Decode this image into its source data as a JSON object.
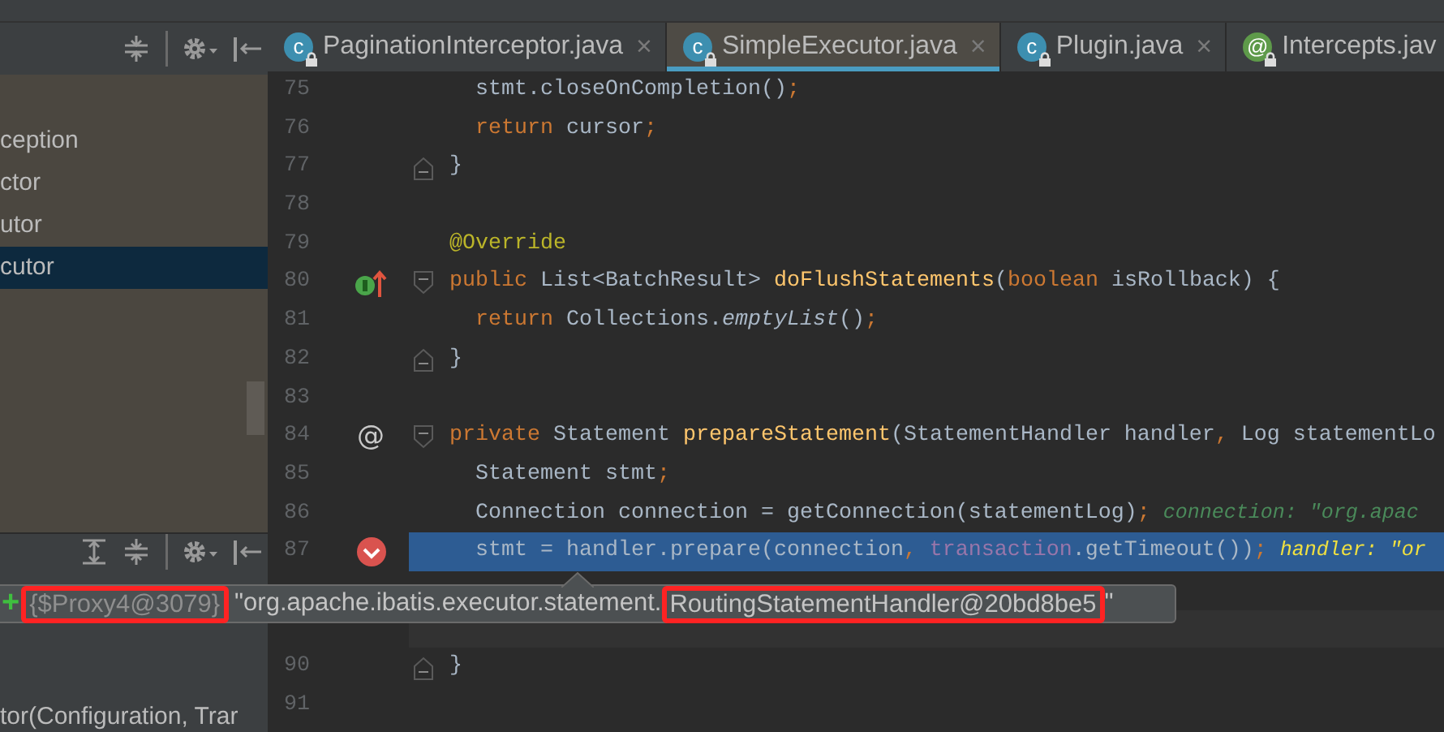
{
  "structure_panel": {
    "items": [
      {
        "label": "ception",
        "selected": false
      },
      {
        "label": "ctor",
        "selected": false
      },
      {
        "label": "utor",
        "selected": false
      },
      {
        "label": "cutor",
        "selected": true
      }
    ],
    "bottom_text": "tor(Configuration, Trar"
  },
  "tabs": [
    {
      "label": "PaginationInterceptor.java",
      "selected": false,
      "glyph": "c",
      "color": "#3d8fb0",
      "close": "×"
    },
    {
      "label": "SimpleExecutor.java",
      "selected": true,
      "glyph": "c",
      "color": "#3d8fb0",
      "close": "×"
    },
    {
      "label": "Plugin.java",
      "selected": false,
      "glyph": "c",
      "color": "#3d8fb0",
      "close": "×"
    },
    {
      "label": "Intercepts.jav",
      "selected": false,
      "glyph": "@",
      "color": "#5e9a4a"
    }
  ],
  "lines": [
    {
      "number": "75",
      "tokens": [
        {
          "text": "  stmt.closeOnCompletion()",
          "kind": "plain"
        },
        {
          "text": ";",
          "kind": "kw"
        }
      ]
    },
    {
      "number": "76",
      "tokens": [
        {
          "text": "  return",
          "kind": "kw"
        },
        {
          "text": " cursor",
          "kind": "plain"
        },
        {
          "text": ";",
          "kind": "kw"
        }
      ]
    },
    {
      "number": "77",
      "fold": {
        "kind": "end"
      },
      "tokens": [
        {
          "text": "}",
          "kind": "plain"
        }
      ]
    },
    {
      "number": "78"
    },
    {
      "number": "79",
      "tokens": [
        {
          "text": "@Override",
          "kind": "annotation"
        }
      ]
    },
    {
      "number": "80",
      "gutter": {
        "kind": "implements"
      },
      "fold": {
        "kind": "start"
      },
      "tokens": [
        {
          "text": "public",
          "kind": "kw"
        },
        {
          "text": " List<BatchResult> ",
          "kind": "plain"
        },
        {
          "text": "doFlushStatements",
          "kind": "method"
        },
        {
          "text": "(",
          "kind": "plain"
        },
        {
          "text": "boolean",
          "kind": "kw"
        },
        {
          "text": " isRollback) {",
          "kind": "plain"
        }
      ]
    },
    {
      "number": "81",
      "tokens": [
        {
          "text": "  return",
          "kind": "kw"
        },
        {
          "text": " Collections.",
          "kind": "plain"
        },
        {
          "text": "emptyList",
          "kind": "static"
        },
        {
          "text": "()",
          "kind": "plain"
        },
        {
          "text": ";",
          "kind": "kw"
        }
      ]
    },
    {
      "number": "82",
      "fold": {
        "kind": "end"
      },
      "tokens": [
        {
          "text": "}",
          "kind": "plain"
        }
      ]
    },
    {
      "number": "83"
    },
    {
      "number": "84",
      "gutter": {
        "kind": "glyph",
        "glyph": "@"
      },
      "fold": {
        "kind": "start"
      },
      "tokens": [
        {
          "text": "private",
          "kind": "kw"
        },
        {
          "text": " Statement ",
          "kind": "plain"
        },
        {
          "text": "prepareStatement",
          "kind": "method"
        },
        {
          "text": "(StatementHandler handler",
          "kind": "plain"
        },
        {
          "text": ",",
          "kind": "kw"
        },
        {
          "text": " Log statementLo",
          "kind": "plain"
        }
      ]
    },
    {
      "number": "85",
      "tokens": [
        {
          "text": "  Statement stmt",
          "kind": "plain"
        },
        {
          "text": ";",
          "kind": "kw"
        }
      ]
    },
    {
      "number": "86",
      "tokens": [
        {
          "text": "  Connection connection = getConnection(statementLog)",
          "kind": "plain"
        },
        {
          "text": ";",
          "kind": "kw"
        }
      ],
      "hint": "connection: \"org.apac"
    },
    {
      "number": "87",
      "highlighted": true,
      "gutter": {
        "kind": "breakpoint"
      },
      "tokens": [
        {
          "text": "  stmt = handler.prepare(connection",
          "kind": "plain"
        },
        {
          "text": ",",
          "kind": "kw"
        },
        {
          "text": " transaction",
          "kind": "field"
        },
        {
          "text": ".getTimeout())",
          "kind": "plain"
        },
        {
          "text": ";",
          "kind": "kw"
        }
      ],
      "hint": "handler: \"or"
    },
    {
      "caret_line": true
    },
    {
      "number": "90",
      "fold": {
        "kind": "end"
      },
      "tokens": [
        {
          "text": "}",
          "kind": "plain"
        }
      ]
    },
    {
      "number": "91"
    }
  ],
  "value_tooltip": {
    "expand": "+",
    "object_id": "{$Proxy4@3079}",
    "value_start": "\"org.apache.ibatis.executor.statement.",
    "value_marked": "RoutingStatementHandler@20bd8be5",
    "value_end": "\""
  }
}
